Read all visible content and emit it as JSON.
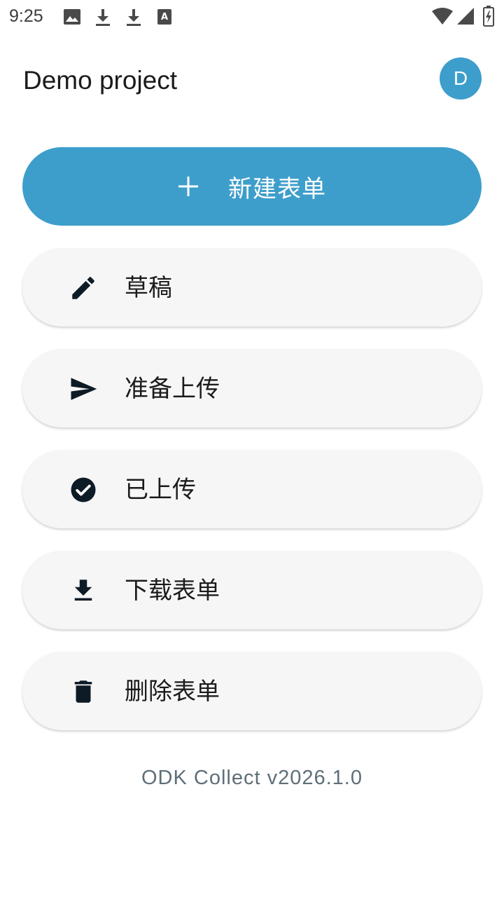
{
  "status_bar": {
    "time": "9:25",
    "icons": [
      "image-icon",
      "download-icon",
      "download-icon",
      "font-icon",
      "wifi-icon",
      "signal-icon",
      "battery-charging-icon"
    ]
  },
  "header": {
    "title": "Demo project",
    "avatar_letter": "D"
  },
  "actions": {
    "start_new_form": {
      "label": "新建表单",
      "icon": "plus-icon"
    },
    "drafts": {
      "label": "草稿",
      "icon": "pencil-icon"
    },
    "ready_to_send": {
      "label": "准备上传",
      "icon": "send-icon"
    },
    "sent": {
      "label": "已上传",
      "icon": "check-circle-icon"
    },
    "download_forms": {
      "label": "下载表单",
      "icon": "download-icon"
    },
    "delete_forms": {
      "label": "删除表单",
      "icon": "trash-icon"
    }
  },
  "footer": {
    "version": "ODK Collect v2026.1.0"
  },
  "colors": {
    "primary": "#3e9ecb",
    "surface": "#f6f6f6",
    "icon_dark": "#0d1b26",
    "version_text": "#5f6f78"
  }
}
